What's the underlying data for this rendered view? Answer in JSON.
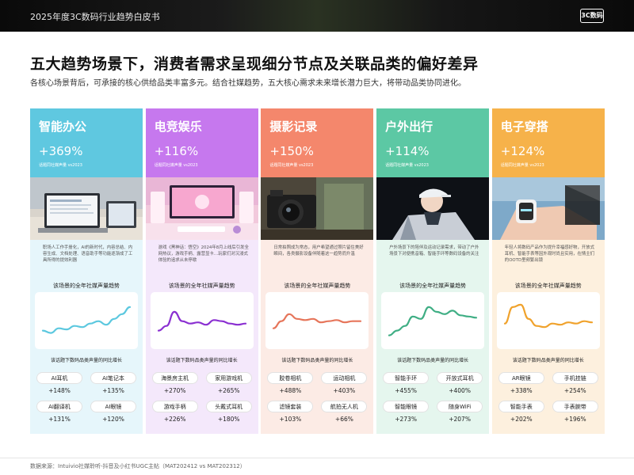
{
  "header": {
    "title": "2025年度3C数码行业趋势白皮书",
    "logo_text": "3C数码"
  },
  "headline": "五大趋势场景下，消费者需求呈现细分节点及关联品类的偏好差异",
  "subline": "各核心场景背后，可承接的核心供给品类丰富多元。结合社媒趋势，五大核心需求未来增长潜力巨大，将带动品类协同进化。",
  "labels": {
    "note": "话题同社媒声量 vs2023",
    "trend_title": "该场景的全年社媒声量趋势",
    "growth_title": "该话题下数码品类声量的同比增长"
  },
  "cards": [
    {
      "name": "智能办公",
      "pct": "+369%",
      "color": "#5fc8e0",
      "bg": "#e6f6fb",
      "line_color": "#5cc8df",
      "desc": "职场人工作手册化，AI的新时代，内容总结、内容生成、文档处理、语音助手等功能逐渐成了工具所得的提效利器",
      "trend": [
        14,
        12,
        16,
        15,
        18,
        17,
        20,
        22,
        19,
        24,
        28,
        34
      ],
      "products": [
        {
          "label": "AI耳机",
          "value": "+148%"
        },
        {
          "label": "AI笔记本",
          "value": "+135%"
        },
        {
          "label": "AI翻译机",
          "value": "+131%"
        },
        {
          "label": "AI眼镜",
          "value": "+120%"
        }
      ]
    },
    {
      "name": "电竞娱乐",
      "pct": "+116%",
      "color": "#c678ee",
      "bg": "#f4e8fb",
      "line_color": "#8a2fd1",
      "desc": "游戏《黑神话：悟空》2024年8月上线后引发全网热议，游戏手柄、露营显卡…玩家们对沉浸式体验的追求从未停歇",
      "trend": [
        14,
        18,
        30,
        22,
        20,
        21,
        19,
        23,
        22,
        20,
        19,
        20
      ],
      "products": [
        {
          "label": "海景房主机",
          "value": "+270%"
        },
        {
          "label": "家用游戏机",
          "value": "+265%"
        },
        {
          "label": "游戏手柄",
          "value": "+226%"
        },
        {
          "label": "头戴式耳机",
          "value": "+180%"
        }
      ]
    },
    {
      "name": "摄影记录",
      "pct": "+150%",
      "color": "#f4876c",
      "bg": "#fcebe5",
      "line_color": "#e6755a",
      "desc": "日常拍照成为常态，用户希望通过照片留住美好瞬间，各类摄影设备伴随着这一趋势而升温",
      "trend": [
        16,
        22,
        28,
        24,
        23,
        24,
        21,
        22,
        23,
        21,
        22,
        22
      ],
      "products": [
        {
          "label": "胶卷相机",
          "value": "+488%"
        },
        {
          "label": "运动相机",
          "value": "+403%"
        },
        {
          "label": "滤镜套装",
          "value": "+103%"
        },
        {
          "label": "航拍无人机",
          "value": "+66%"
        }
      ]
    },
    {
      "name": "户外出行",
      "pct": "+114%",
      "color": "#5cc8a4",
      "bg": "#e5f6ee",
      "line_color": "#3fae84",
      "desc": "户外场景下的陪伴及运动记录需求，带动了户外场景下对便携音箱、智能手环等数码设备的关注",
      "trend": [
        10,
        14,
        18,
        26,
        24,
        34,
        30,
        28,
        31,
        27,
        26,
        25
      ],
      "products": [
        {
          "label": "智能手环",
          "value": "+455%"
        },
        {
          "label": "开放式耳机",
          "value": "+400%"
        },
        {
          "label": "智能眼镜",
          "value": "+273%"
        },
        {
          "label": "随身WiFi",
          "value": "+207%"
        }
      ]
    },
    {
      "name": "电子穿搭",
      "pct": "+124%",
      "color": "#f6b24a",
      "bg": "#fdf0de",
      "line_color": "#f0a22c",
      "desc": "年轻人将数码产品作为提升幸福感好物，开放式耳机、智能手表等因外观时尚且实用，在情主们的OOTD里频繁出镜",
      "trend": [
        20,
        34,
        36,
        24,
        18,
        17,
        20,
        19,
        21,
        20,
        22,
        21
      ],
      "products": [
        {
          "label": "AR眼镜",
          "value": "+338%"
        },
        {
          "label": "手机挂链",
          "value": "+254%"
        },
        {
          "label": "智能手表",
          "value": "+202%"
        },
        {
          "label": "手表腕带",
          "value": "+196%"
        }
      ]
    }
  ],
  "source": "数据来源：Intuivio社媒聆听-抖音及小红书UGC主帖（MAT202412 vs MAT202312）"
}
